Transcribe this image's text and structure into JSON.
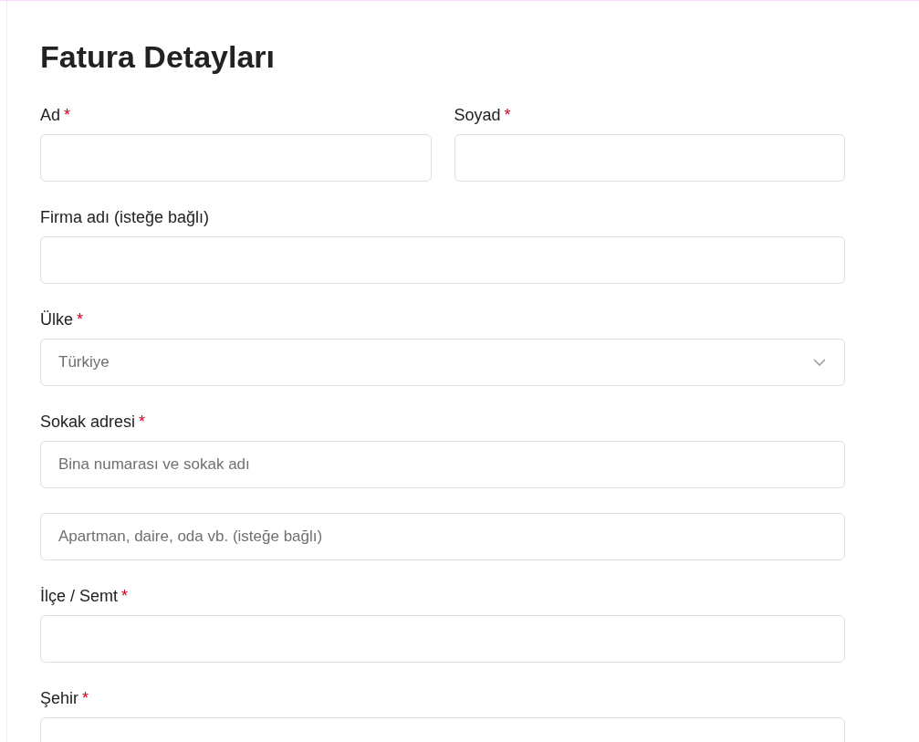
{
  "title": "Fatura Detayları",
  "rows": [
    {
      "fields": [
        {
          "kind": "text",
          "label": "Ad",
          "required_mark": "*"
        },
        {
          "kind": "text",
          "label": "Soyad",
          "required_mark": "*"
        }
      ]
    },
    {
      "fields": [
        {
          "kind": "text",
          "label": "Firma adı (isteğe bağlı)"
        }
      ]
    },
    {
      "fields": [
        {
          "kind": "select",
          "label": "Ülke",
          "required_mark": "*",
          "value": "Türkiye"
        }
      ]
    },
    {
      "fields": [
        {
          "kind": "text",
          "label": "Sokak adresi",
          "required_mark": "*",
          "placeholder": "Bina numarası ve sokak adı"
        }
      ]
    },
    {
      "fields": [
        {
          "kind": "text",
          "placeholder": "Apartman, daire, oda vb. (isteğe bağlı)"
        }
      ]
    },
    {
      "fields": [
        {
          "kind": "text",
          "label": "İlçe / Semt",
          "required_mark": "*"
        }
      ]
    },
    {
      "fields": [
        {
          "kind": "text",
          "label": "Şehir",
          "required_mark": "*"
        }
      ]
    }
  ]
}
